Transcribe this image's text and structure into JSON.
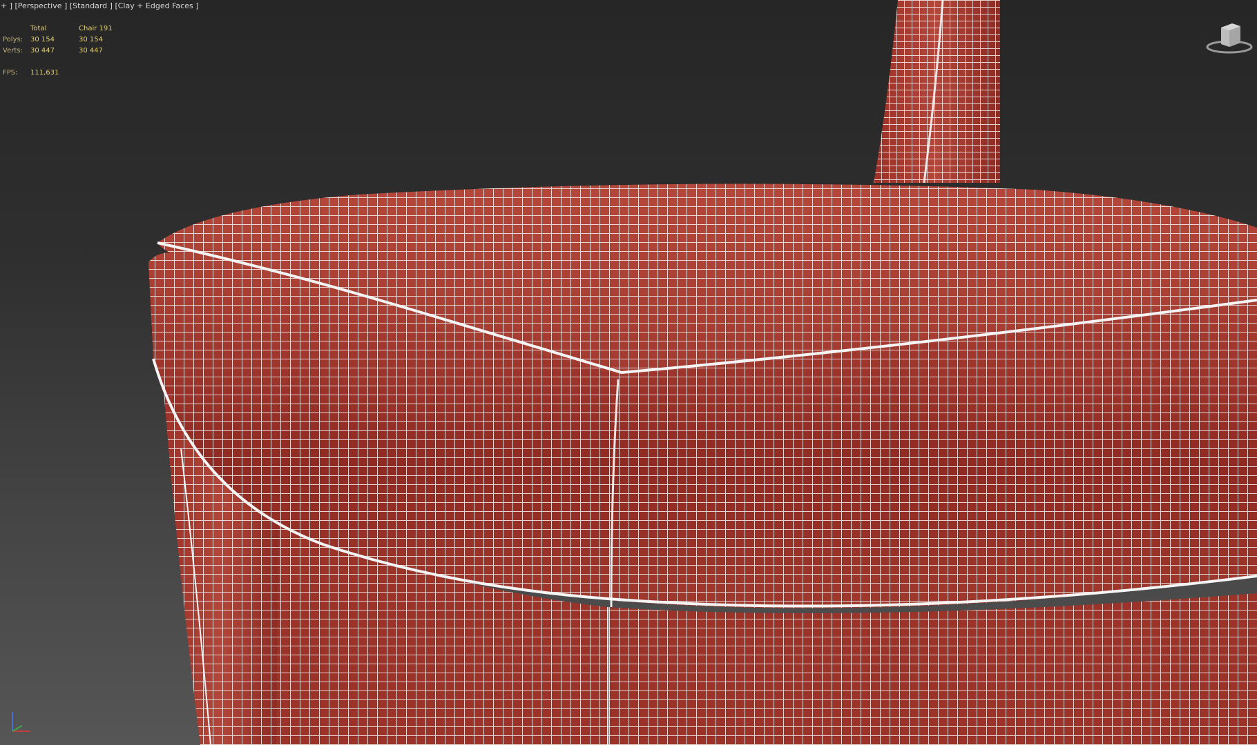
{
  "viewport": {
    "menu_plus": "+ ]",
    "view_label": "[Perspective ]",
    "shading_label": "[Standard ]",
    "style_label": "[Clay + Edged Faces ]"
  },
  "stats": {
    "header_total": "Total",
    "header_object": "Chair 191",
    "polys_label": "Polys:",
    "polys_total": "30 154",
    "polys_object": "30 154",
    "verts_label": "Verts:",
    "verts_total": "30 447",
    "verts_object": "30 447",
    "fps_label": "FPS:",
    "fps_value": "111,631"
  },
  "colors": {
    "mesh_red": "#a8392e",
    "wire": "#f2f2f2",
    "bg_top": "#262626",
    "bg_bottom": "#565656",
    "stat_yellow": "#e3cf6f"
  },
  "icons": {
    "viewcube": "viewcube-icon",
    "axis": "axis-tripod-icon"
  }
}
